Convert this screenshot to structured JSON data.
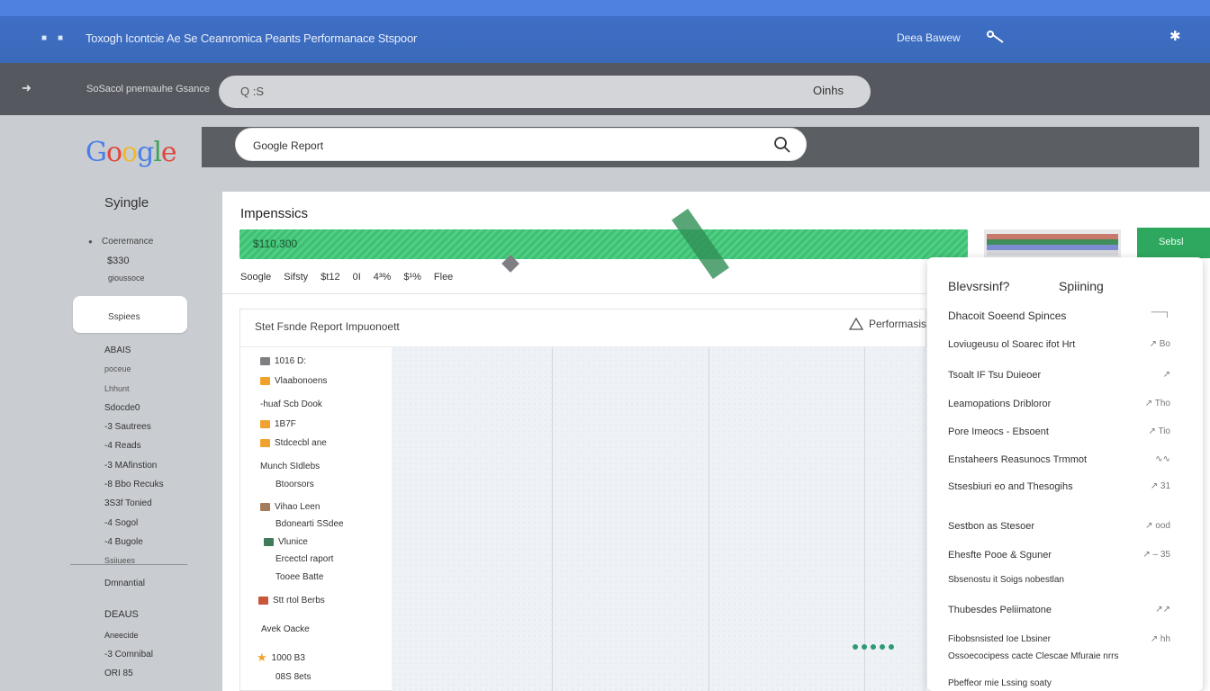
{
  "window": {
    "title": "Toxogh Icontcie Ae Se Ceanromica Peants  Performanace Stspoor",
    "right_label": "Deea Bawew",
    "icons": [
      "minimize-icon",
      "restore-icon",
      "key-icon",
      "pin-icon"
    ]
  },
  "toolbar": {
    "crumb": "SoSacol pnemauhe Gsance",
    "omnibox_text": "Q  :S",
    "omnibox_right": "Oinhs"
  },
  "sidebar": {
    "heading": "Syingle",
    "section": "Coeremance",
    "value": "$330",
    "value_sub": "gioussoce",
    "active_item": "Sspiees",
    "items": [
      "ABAIS",
      "poceue",
      "Lhhunt",
      "Sdocde0",
      "-3 Sautrees",
      "-4 Reads",
      "-3 MAfinstion",
      "-8 Bbo Recuks",
      "3S3f Tonied",
      "-4 Sogol",
      "-4 Bugole",
      "Ssiiuees"
    ],
    "lower_items": [
      "Dmnantial",
      "DEAUS",
      "Aneecide",
      "-3 Comnibal",
      "ORI 85"
    ]
  },
  "search": {
    "value": "Google Report"
  },
  "panel": {
    "title": "Impenssics",
    "green_bar_label": "$110.300",
    "green_chip_label": "Sebsl",
    "metrics": [
      "Soogle",
      "Sifsty",
      "$t12",
      "0I",
      "4³%",
      "$¹%",
      "Flee"
    ]
  },
  "report": {
    "title": "Stet Fsnde Report Impuonoett",
    "warning_label": "Performasis",
    "rows": [
      {
        "label": "1016 D:",
        "icon_color": "#7d7f83"
      },
      {
        "label": "Vlaabonoens",
        "icon_color": "#f0a22f"
      },
      {
        "label": "-huaf Scb Dook",
        "icon_color": ""
      },
      {
        "label": "1B7F",
        "icon_color": "#f0a22f"
      },
      {
        "label": "Stdcecbl ane",
        "icon_color": "#f0a22f"
      },
      {
        "label": "Munch SIdlebs",
        "icon_color": ""
      },
      {
        "label": "Btoorsors",
        "icon_color": ""
      },
      {
        "label": "Vihao Leen",
        "icon_color": "#a67b5b"
      },
      {
        "label": "Bdonearti SSdee",
        "icon_color": ""
      },
      {
        "label": "Vlunice",
        "icon_color": "#3f7a5a"
      },
      {
        "label": "Ercectcl raport",
        "icon_color": ""
      },
      {
        "label": "Tooee Batte",
        "icon_color": ""
      },
      {
        "label": "Stt rtol Berbs",
        "icon_color": "#c9553a"
      },
      {
        "label": "Avek Oacke",
        "icon_color": ""
      },
      {
        "label": "1000 B3",
        "icon_color": "#f0a22f"
      },
      {
        "label": "08S 8ets",
        "icon_color": ""
      }
    ]
  },
  "popup": {
    "heading_left": "Blevsrsinf?",
    "heading_right": "Spiining",
    "items": [
      {
        "label": "Dhacoit Soeend Spinces",
        "value": "──┐"
      },
      {
        "label": "Loviugeusu ol Soarec ifot Hrt",
        "value": "↗ Bo"
      },
      {
        "label": "Tsoalt IF Tsu Duieoer",
        "value": "↗"
      },
      {
        "label": "Leamopations Dribloror",
        "value": "↗ Tho"
      },
      {
        "label": "Pore Imeocs - Ebsoent",
        "value": "↗ Tio"
      },
      {
        "label": "Enstaheers Reasunocs Trmmot",
        "value": "∿∿"
      },
      {
        "label": "Stsesbiuri eo and Thesogihs",
        "value": "↗ 31"
      },
      {
        "label": "Sestbon as Stesoer",
        "value": "↗ ood"
      },
      {
        "label": "Ehesfte Pooe & Sguner",
        "value": "↗ – 35"
      },
      {
        "label": "Sbsenostu it Soigs nobestlan",
        "value": ""
      },
      {
        "label": "Thubesdes Peliimatone",
        "value": "↗↗"
      },
      {
        "label": "Fibobsnsisted Ioe Lbsiner",
        "value": "↗ hh"
      },
      {
        "label": "Ossoecocipess  cacte Clescae Mfuraie nrrs",
        "value": ""
      },
      {
        "label": "Pbeffeor mie Lssing soaty",
        "value": ""
      }
    ]
  }
}
